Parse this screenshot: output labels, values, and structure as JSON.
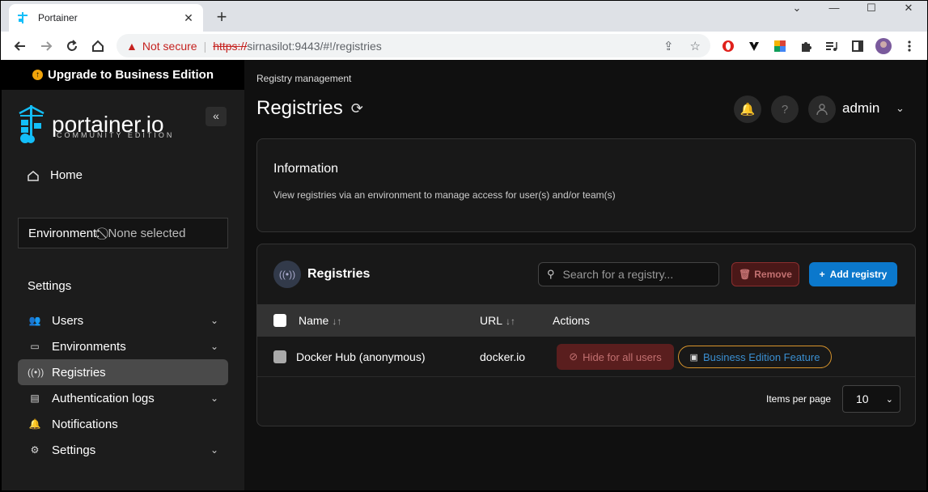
{
  "browser": {
    "tab_title": "Portainer",
    "tab_close": "✕",
    "new_tab": "+",
    "window_controls": [
      "⌄",
      "—",
      "☐",
      "✕"
    ],
    "security_label": "Not secure",
    "url_scheme": "https://",
    "url_rest": "sirnasilot:9443/#!/registries",
    "omnibox_icons": [
      "share-icon",
      "star-icon"
    ],
    "extension_icons": [
      "opera-icon",
      "vivaldi-icon",
      "color-extension-icon",
      "puzzle-icon",
      "playlist-icon",
      "sidepanel-icon",
      "profile-avatar"
    ]
  },
  "sidebar": {
    "upgrade_label": "Upgrade to Business Edition",
    "logo_word": "portainer.io",
    "logo_sub": "COMMUNITY EDITION",
    "collapse": "«",
    "home_label": "Home",
    "environment_label": "Environment:",
    "environment_value": "None selected",
    "settings_heading": "Settings",
    "items": [
      {
        "label": "Users",
        "icon": "users-icon",
        "has_chevron": true,
        "active": false
      },
      {
        "label": "Environments",
        "icon": "environments-icon",
        "has_chevron": true,
        "active": false
      },
      {
        "label": "Registries",
        "icon": "registries-icon",
        "has_chevron": false,
        "active": true
      },
      {
        "label": "Authentication logs",
        "icon": "auth-logs-icon",
        "has_chevron": true,
        "active": false
      },
      {
        "label": "Notifications",
        "icon": "bell-icon",
        "has_chevron": false,
        "active": false
      },
      {
        "label": "Settings",
        "icon": "gear-icon",
        "has_chevron": true,
        "active": false
      }
    ]
  },
  "main": {
    "breadcrumb": "Registry management",
    "title": "Registries",
    "user": "admin",
    "info": {
      "heading": "Information",
      "text": "View registries via an environment to manage access for user(s) and/or team(s)"
    },
    "registries": {
      "heading": "Registries",
      "search_placeholder": "Search for a registry...",
      "remove_label": "Remove",
      "add_label": "Add registry",
      "columns": [
        "Name",
        "URL",
        "Actions"
      ],
      "rows": [
        {
          "name": "Docker Hub (anonymous)",
          "url": "docker.io",
          "hide_label": "Hide for all users",
          "be_label": "Business Edition Feature"
        }
      ],
      "items_per_page_label": "Items per page",
      "items_per_page_value": "10"
    }
  },
  "colors": {
    "accent": "#0b78cc",
    "danger": "#8b2e2e",
    "be_border": "#d8942c",
    "sidebar_bg": "#1c1c1c",
    "main_bg": "#101010"
  }
}
